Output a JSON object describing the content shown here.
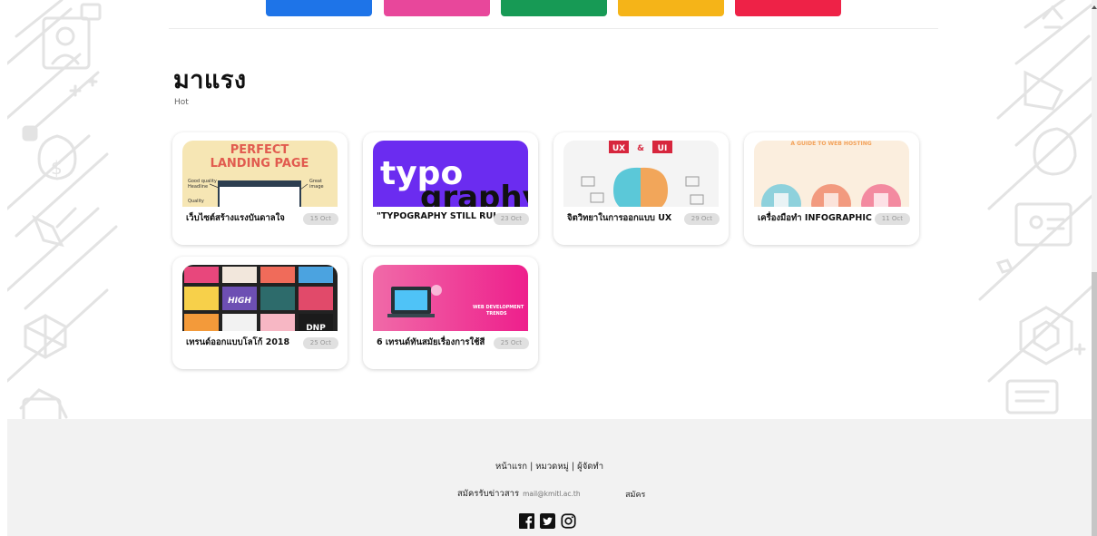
{
  "colors": {
    "pill_blue": "#1e74e8",
    "pill_pink": "#e8479b",
    "pill_green": "#179a55",
    "pill_yellow": "#f5b418",
    "pill_red": "#ee2247",
    "footer_bg": "#f2f2f2",
    "badge_bg": "#e0e0e0"
  },
  "section": {
    "title": "มาแรง",
    "subtitle": "Hot"
  },
  "cards": [
    {
      "title": "เว็บไซต์สร้างแรงบันดาลใจ",
      "date": "15 Oct",
      "thumb_text": "PERFECT LANDING PAGE"
    },
    {
      "title": "\"TYPOGRAPHY STILL RULES\"",
      "date": "23 Oct",
      "thumb_text": "typography"
    },
    {
      "title": "จิตวิทยาในการออกแบบ UX",
      "date": "29 Oct",
      "thumb_text": "UX & UI"
    },
    {
      "title": "เครื่องมือทำ INFOGRAPHIC",
      "date": "11 Oct",
      "thumb_text": "A GUIDE TO WEB HOSTING"
    },
    {
      "title": "เทรนด์ออกแบบโลโก้ 2018",
      "date": "25 Oct",
      "thumb_text": "HIGH"
    },
    {
      "title": "6 เทรนด์ทันสมัยเรื่องการใช้สี",
      "date": "25 Oct",
      "thumb_text": "WEB DEVELOPMENT TRENDS"
    }
  ],
  "footer": {
    "links": [
      "หน้าแรก",
      "หมวดหมู่",
      "ผู้จัดทำ"
    ],
    "separator": "|",
    "subscribe_label": "สมัครรับข่าวสาร",
    "email_placeholder": "mail@kmitl.ac.th",
    "subscribe_button": "สมัคร",
    "social": [
      "facebook-icon",
      "twitter-icon",
      "instagram-icon"
    ]
  }
}
